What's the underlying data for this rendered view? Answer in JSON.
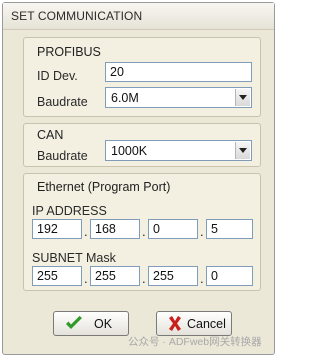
{
  "window": {
    "title": "SET COMMUNICATION"
  },
  "profibus": {
    "group_title": "PROFIBUS",
    "id_label": "ID Dev.",
    "id_value": "20",
    "baudrate_label": "Baudrate",
    "baudrate_value": "6.0M"
  },
  "can": {
    "group_title": "CAN",
    "baudrate_label": "Baudrate",
    "baudrate_value": "1000K"
  },
  "ethernet": {
    "group_title": "Ethernet (Program Port)",
    "ip_label": "IP ADDRESS",
    "ip": [
      "192",
      "168",
      "0",
      "5"
    ],
    "subnet_label": "SUBNET Mask",
    "subnet": [
      "255",
      "255",
      "255",
      "0"
    ],
    "separator": "."
  },
  "buttons": {
    "ok_label": "OK",
    "cancel_label": "Cancel"
  },
  "icons": {
    "ok": "checkmark-icon",
    "cancel": "x-icon",
    "dropdown": "chevron-down-icon"
  },
  "colors": {
    "ok_icon": "#2f9a2a",
    "cancel_icon": "#c8201c",
    "field_border": "#7f9db9"
  },
  "watermark": {
    "text": "公众号 · ADFweb网关转换器"
  }
}
